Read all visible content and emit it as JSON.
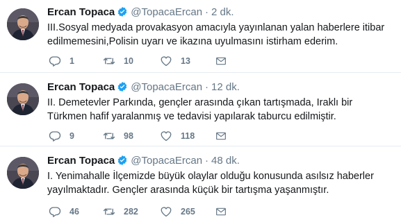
{
  "colors": {
    "verified": "#1da1f2",
    "secondary_text": "#657786",
    "primary_text": "#14171a",
    "divider": "#e6ecf0"
  },
  "icons": {
    "reply": "reply-icon",
    "retweet": "retweet-icon",
    "like": "heart-icon",
    "message": "envelope-icon",
    "verified": "verified-badge-icon"
  },
  "tweets": [
    {
      "name": "Ercan Topaca",
      "handle": "@TopacaErcan",
      "separator": "·",
      "time": "2 dk.",
      "text": "III.Sosyal medyada provakasyon amacıyla yayınlanan yalan haberlere itibar edilmemesini,Polisin uyarı ve ikazına uyulmasını istirham ederim.",
      "replies": "1",
      "retweets": "10",
      "likes": "13"
    },
    {
      "name": "Ercan Topaca",
      "handle": "@TopacaErcan",
      "separator": "·",
      "time": "12 dk.",
      "text": "II. Demetevler Parkında, gençler arasında çıkan tartışmada, Iraklı bir Türkmen hafif yaralanmış ve tedavisi yapılarak taburcu edilmiştir.",
      "replies": "9",
      "retweets": "98",
      "likes": "118"
    },
    {
      "name": "Ercan Topaca",
      "handle": "@TopacaErcan",
      "separator": "·",
      "time": "48 dk.",
      "text": "I. Yenimahalle İlçemizde büyük olaylar olduğu konusunda asılsız haberler yayılmaktadır. Gençler arasında küçük bir tartışma yaşanmıştır.",
      "replies": "46",
      "retweets": "282",
      "likes": "265"
    }
  ]
}
